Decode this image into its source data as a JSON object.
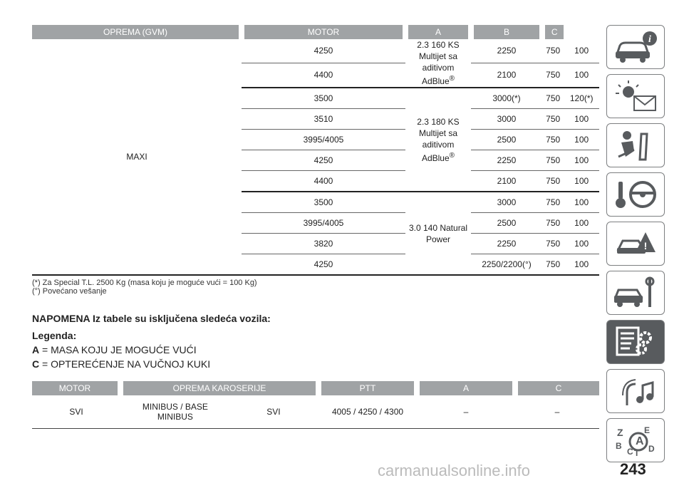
{
  "table1": {
    "headers": [
      "OPREMA (GVM)",
      "MOTOR",
      "A",
      "B",
      "C"
    ],
    "oprema": "MAXI",
    "groups": [
      {
        "motor_line1": "2.3 160 KS Multijet sa aditivom",
        "motor_line2": "AdBlue",
        "motor_sup": "®",
        "rows": [
          {
            "gvm": "4250",
            "a": "2250",
            "b": "750",
            "c": "100"
          },
          {
            "gvm": "4400",
            "a": "2100",
            "b": "750",
            "c": "100"
          }
        ]
      },
      {
        "motor_line1": "2.3 180 KS Multijet sa aditivom",
        "motor_line2": "AdBlue",
        "motor_sup": "®",
        "rows": [
          {
            "gvm": "3500",
            "a": "3000(*)",
            "b": "750",
            "c": "120(*)"
          },
          {
            "gvm": "3510",
            "a": "3000",
            "b": "750",
            "c": "100"
          },
          {
            "gvm": "3995/4005",
            "a": "2500",
            "b": "750",
            "c": "100"
          },
          {
            "gvm": "4250",
            "a": "2250",
            "b": "750",
            "c": "100"
          },
          {
            "gvm": "4400",
            "a": "2100",
            "b": "750",
            "c": "100"
          }
        ]
      },
      {
        "motor_line1": "3.0 140 Natural Power",
        "motor_line2": "",
        "motor_sup": "",
        "rows": [
          {
            "gvm": "3500",
            "a": "3000",
            "b": "750",
            "c": "100"
          },
          {
            "gvm": "3995/4005",
            "a": "2500",
            "b": "750",
            "c": "100"
          },
          {
            "gvm": "3820",
            "a": "2250",
            "b": "750",
            "c": "100"
          },
          {
            "gvm": "4250",
            "a": "2250/2200(°)",
            "b": "750",
            "c": "100"
          }
        ]
      }
    ]
  },
  "notes": {
    "note1": "(*) Za Special T.L. 2500 Kg (masa koju je moguće vući = 100 Kg)",
    "note2": "(°) Povećano vešanje"
  },
  "heading": "NAPOMENA Iz tabele su isključena sledeća vozila:",
  "legend": {
    "title": "Legenda:",
    "a_key": "A",
    "a_text": " = MASA KOJU JE MOGUĆE VUĆI",
    "c_key": "C",
    "c_text": " = OPTEREĆENJE NA VUČNOJ KUKI"
  },
  "table2": {
    "headers": [
      "MOTOR",
      "OPREMA KAROSERIJE",
      "PTT",
      "A",
      "C"
    ],
    "row": {
      "motor": "SVI",
      "oprema_line1": "MINIBUS / BASE",
      "oprema_line2": "MINIBUS",
      "motor2": "SVI",
      "ptt": "4005 / 4250 / 4300",
      "a": "–",
      "c": "–"
    }
  },
  "sidebar": {
    "tabs": [
      {
        "icon": "car-info-icon"
      },
      {
        "icon": "warning-lights-icon"
      },
      {
        "icon": "airbag-seat-icon"
      },
      {
        "icon": "key-steering-icon"
      },
      {
        "icon": "accident-warning-icon"
      },
      {
        "icon": "car-tools-icon"
      },
      {
        "icon": "technical-data-icon",
        "active": true
      },
      {
        "icon": "multimedia-icon"
      },
      {
        "icon": "alphabet-index-icon"
      }
    ]
  },
  "page_number": "243",
  "watermark": "carmanualsonline.info"
}
